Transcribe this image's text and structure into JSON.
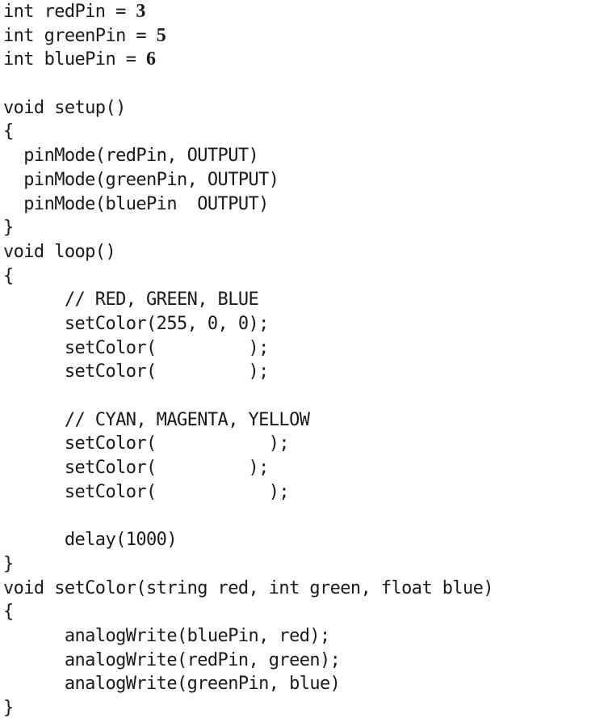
{
  "code": {
    "lines": [
      {
        "text": "int redPin = ",
        "value": "3"
      },
      {
        "text": "int greenPin = ",
        "value": "5"
      },
      {
        "text": "int bluePin = ",
        "value": "6"
      },
      {
        "text": ""
      },
      {
        "text": "void setup()"
      },
      {
        "text": "{"
      },
      {
        "text": "  pinMode(redPin, OUTPUT)"
      },
      {
        "text": "  pinMode(greenPin, OUTPUT)"
      },
      {
        "text": "  pinMode(bluePin  OUTPUT)"
      },
      {
        "text": "}"
      },
      {
        "text": "void loop()"
      },
      {
        "text": "{"
      },
      {
        "text": "      // RED, GREEN, BLUE"
      },
      {
        "text": "      setColor(255, 0, 0);"
      },
      {
        "text": "      setColor(         );"
      },
      {
        "text": "      setColor(         );"
      },
      {
        "text": ""
      },
      {
        "text": "      // CYAN, MAGENTA, YELLOW"
      },
      {
        "text": "      setColor(           );"
      },
      {
        "text": "      setColor(         );"
      },
      {
        "text": "      setColor(           );"
      },
      {
        "text": ""
      },
      {
        "text": "      delay(1000)"
      },
      {
        "text": "}"
      },
      {
        "text": "void setColor(string red, int green, float blue)"
      },
      {
        "text": "{"
      },
      {
        "text": "      analogWrite(bluePin, red);"
      },
      {
        "text": "      analogWrite(redPin, green);"
      },
      {
        "text": "      analogWrite(greenPin, blue)"
      },
      {
        "text": "}"
      }
    ]
  }
}
